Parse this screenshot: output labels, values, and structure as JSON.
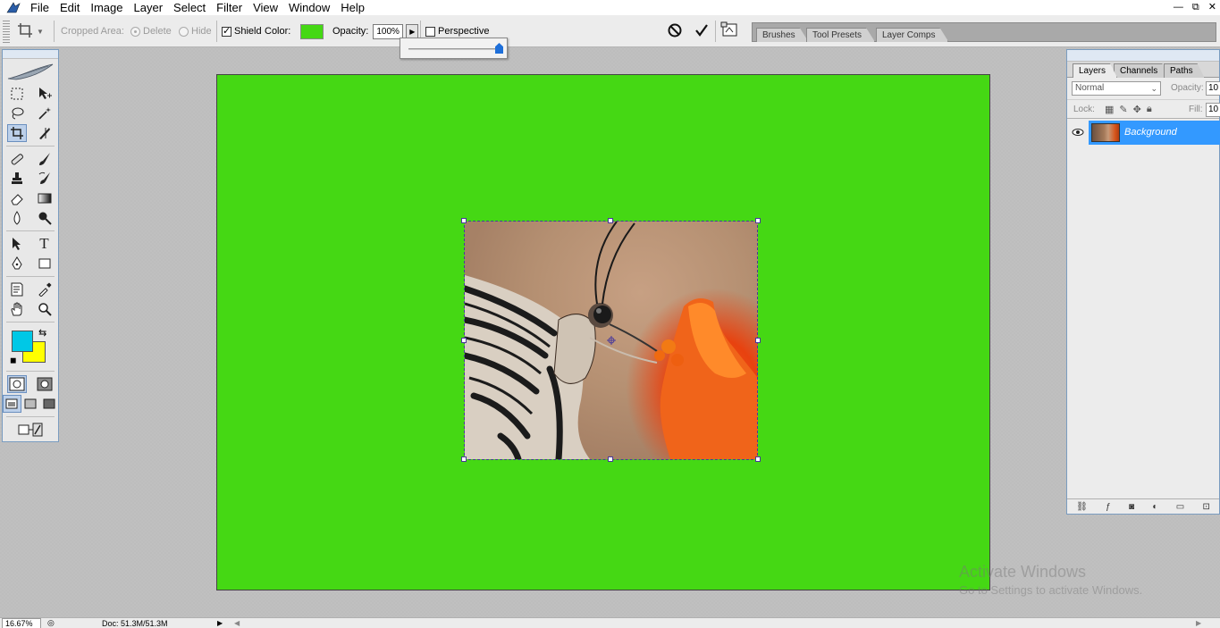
{
  "menu": {
    "items": [
      "File",
      "Edit",
      "Image",
      "Layer",
      "Select",
      "Filter",
      "View",
      "Window",
      "Help"
    ]
  },
  "window_controls": {
    "minimize": "—",
    "restore": "⧉",
    "close": "✕"
  },
  "options": {
    "cropped_area_label": "Cropped Area:",
    "delete_label": "Delete",
    "hide_label": "Hide",
    "shield_label": "Shield",
    "shield_checked": true,
    "color_label": "Color:",
    "shield_color": "#45d814",
    "opacity_label": "Opacity:",
    "opacity_value": "100%",
    "perspective_label": "Perspective",
    "perspective_checked": false,
    "opacity_slider_level": 1.0
  },
  "palette_well": {
    "tabs": [
      "Brushes",
      "Tool Presets",
      "Layer Comps"
    ]
  },
  "toolbox": {
    "foreground_color": "#00c8e6",
    "background_color": "#ffff00"
  },
  "canvas": {
    "background_color": "#45d814"
  },
  "layers_panel": {
    "tabs": [
      "Layers",
      "Channels",
      "Paths"
    ],
    "blend_mode": "Normal",
    "opacity_label": "Opacity:",
    "opacity_value": "10",
    "lock_label": "Lock:",
    "fill_label": "Fill:",
    "fill_value": "10",
    "layers": [
      {
        "name": "Background",
        "visible": true,
        "selected": true
      }
    ]
  },
  "status": {
    "zoom": "16.67%",
    "doc_info": "Doc: 51.3M/51.3M"
  },
  "watermark": {
    "title": "Activate Windows",
    "subtitle": "Go to Settings to activate Windows."
  },
  "colors": {
    "accent": "#3399ff",
    "panel_bg": "#ececec"
  }
}
